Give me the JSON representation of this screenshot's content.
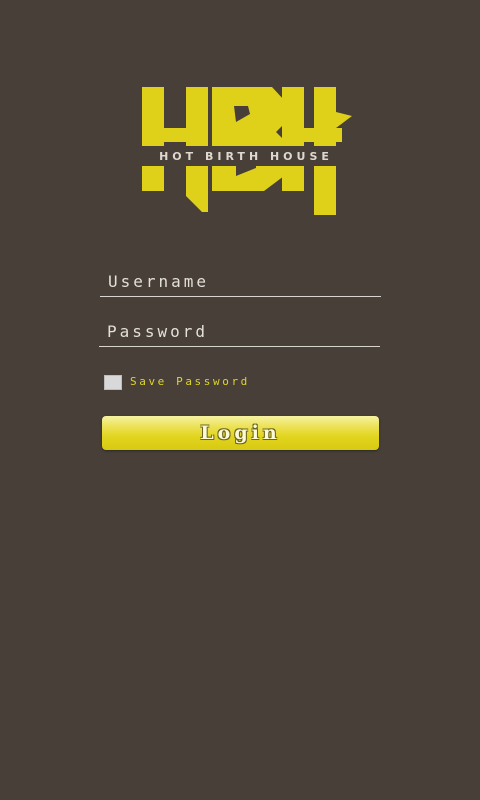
{
  "logo": {
    "letters": "HBH",
    "tagline": "HOT BIRTH HOUSE",
    "color": "#dfd11a"
  },
  "login_form": {
    "username_placeholder": "Username",
    "password_placeholder": "Password",
    "save_password_label": "Save Password",
    "save_password_checked": false,
    "login_button_label": "Login"
  },
  "colors": {
    "background": "#473f38",
    "accent": "#e0d42a"
  }
}
